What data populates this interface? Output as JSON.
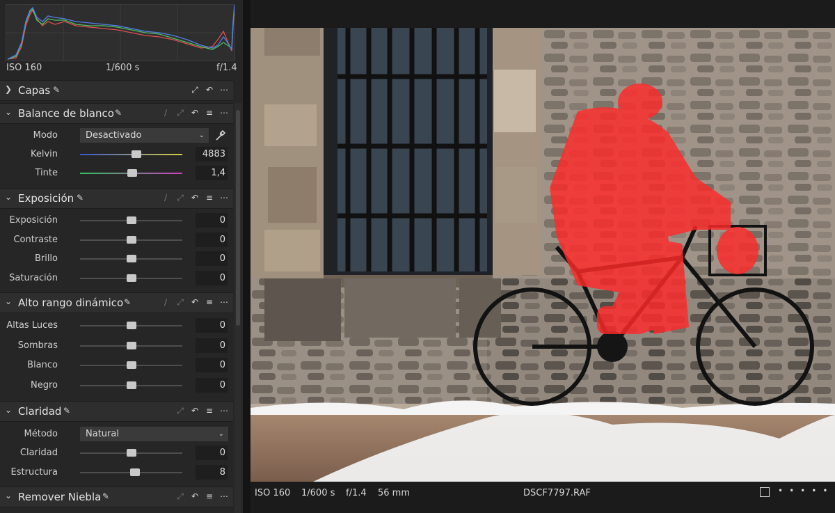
{
  "histogram": {
    "iso": "ISO 160",
    "shutter": "1/600 s",
    "aperture": "f/1.4"
  },
  "panels": {
    "layers": {
      "title": "Capas"
    },
    "white_balance": {
      "title": "Balance de blanco",
      "mode_label": "Modo",
      "mode_value": "Desactivado",
      "kelvin_label": "Kelvin",
      "kelvin_value": "4883",
      "kelvin_level": 0.55,
      "tint_label": "Tinte",
      "tint_value": "1,4",
      "tint_level": 0.51
    },
    "exposure": {
      "title": "Exposición",
      "rows": [
        {
          "label": "Exposición",
          "value": "0",
          "level": 0.5
        },
        {
          "label": "Contraste",
          "value": "0",
          "level": 0.5
        },
        {
          "label": "Brillo",
          "value": "0",
          "level": 0.5
        },
        {
          "label": "Saturación",
          "value": "0",
          "level": 0.5
        }
      ]
    },
    "hdr": {
      "title": "Alto rango dinámico",
      "rows": [
        {
          "label": "Altas Luces",
          "value": "0",
          "level": 0.5
        },
        {
          "label": "Sombras",
          "value": "0",
          "level": 0.5
        },
        {
          "label": "Blanco",
          "value": "0",
          "level": 0.5
        },
        {
          "label": "Negro",
          "value": "0",
          "level": 0.5
        }
      ]
    },
    "clarity": {
      "title": "Claridad",
      "method_label": "Método",
      "method_value": "Natural",
      "rows": [
        {
          "label": "Claridad",
          "value": "0",
          "level": 0.5
        },
        {
          "label": "Estructura",
          "value": "8",
          "level": 0.54
        }
      ]
    },
    "dehaze": {
      "title": "Remover Niebla"
    }
  },
  "viewer": {
    "iso": "ISO 160",
    "shutter": "1/600 s",
    "aperture": "f/1.4",
    "focal": "56 mm",
    "filename": "DSCF7797.RAF"
  },
  "colors": {
    "mask": "#ff2a2a",
    "panel_bg": "#262626",
    "header_bg": "#2e2e2e"
  }
}
